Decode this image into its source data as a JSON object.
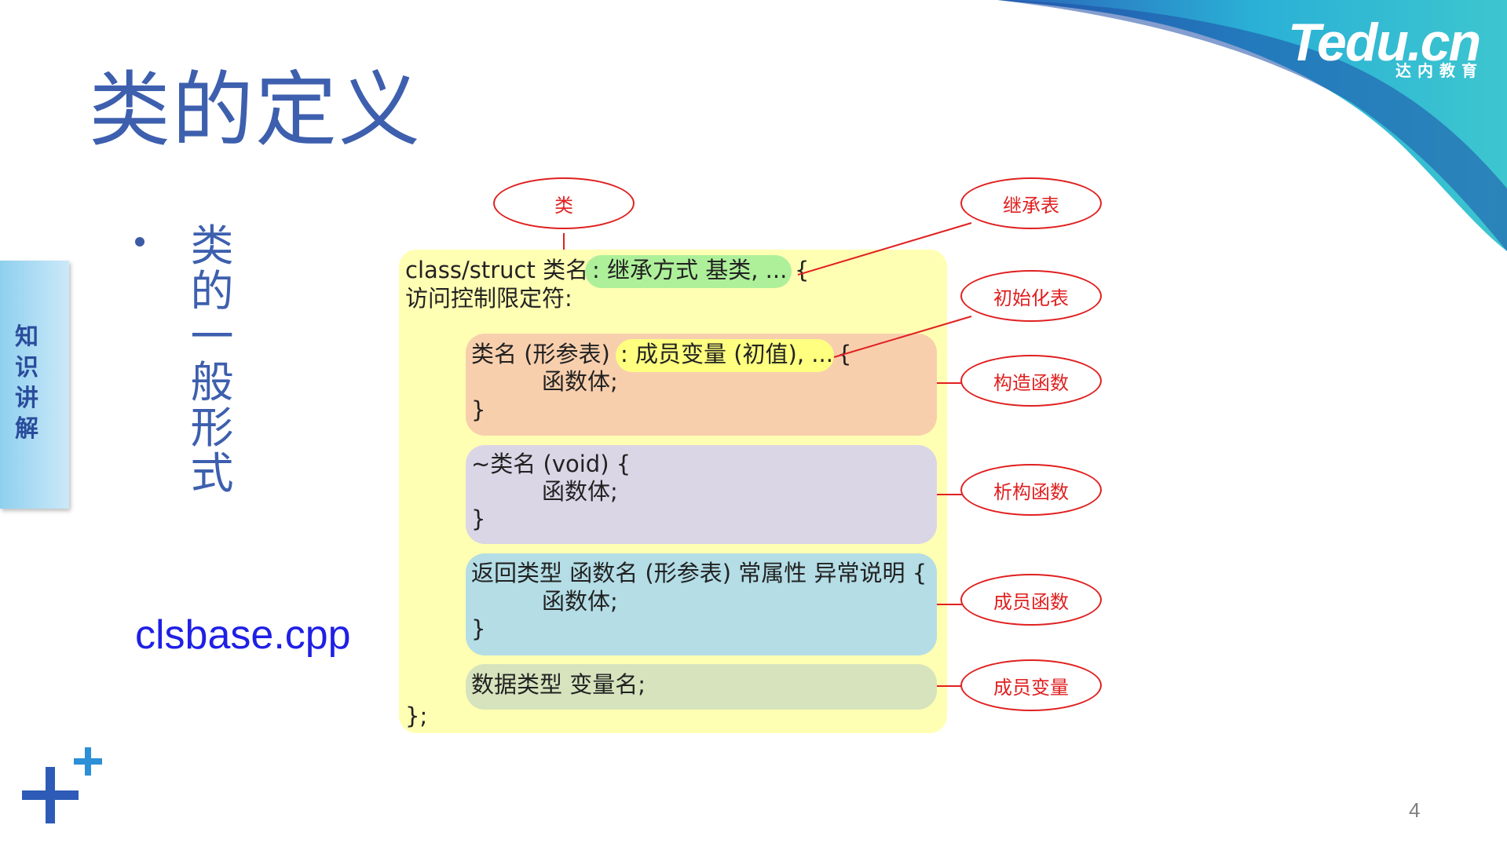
{
  "title": "类的定义",
  "logo": {
    "main": "Tedu.cn",
    "sub": "达内教育"
  },
  "side_tab": "知识讲解",
  "bullet_text": "类的一般形式",
  "file_link": "clsbase.cpp",
  "page_number": "4",
  "code": {
    "head_prefix": "class/struct 类名 ",
    "inherit": ": 继承方式 基类, ...",
    "head_brace": "{",
    "access": "访问控制限定符:",
    "ctor_prefix": "类名 (形参表) ",
    "init": ": 成员变量 (初值), ...",
    "ctor_brace": "{",
    "ctor_body": "函数体;",
    "ctor_close": "}",
    "dtor_head": "~类名 (void) {",
    "dtor_body": "函数体;",
    "dtor_close": "}",
    "func_head": "返回类型 函数名 (形参表) 常属性 异常说明 {",
    "func_body": "函数体;",
    "func_close": "}",
    "var_decl": "数据类型 变量名;",
    "class_close": "};"
  },
  "labels": {
    "class": "类",
    "inherit_list": "继承表",
    "init_list": "初始化表",
    "constructor": "构造函数",
    "destructor": "析构函数",
    "member_function": "成员函数",
    "member_variable": "成员变量"
  },
  "colors": {
    "title": "#3d5fae",
    "label_border": "#e02020",
    "outer_box": "#ffffb3",
    "ctor_box": "#f8cfad",
    "dtor_box": "#dad6e6",
    "func_box": "#b4dde6",
    "var_box": "#d6e3bd",
    "inherit_pill": "#aef09a",
    "init_pill": "#ffff80",
    "link": "#1f1fe6"
  }
}
